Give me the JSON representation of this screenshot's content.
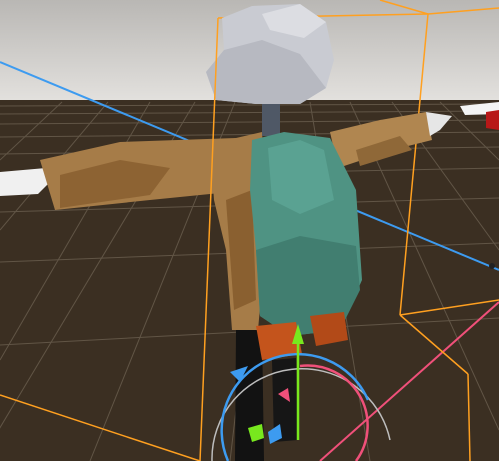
{
  "viewport": {
    "sky_top": "#b9b7b4",
    "sky_bottom": "#e3e1de",
    "ground": "#3b2f22",
    "grid_line": "#6e6252",
    "x_axis_color": "#3d9bf0",
    "z_axis_color": "#f0507a",
    "y_axis_color": "#78e81e",
    "bounds_color": "#ffa020"
  },
  "character": {
    "head_color": "#c9cbd2",
    "coat_color": "#a67c48",
    "backpack_color": "#4f9383",
    "boots_color": "#c4541c",
    "legs_color": "#121212",
    "hands_color": "#e6e6e6"
  },
  "gizmo": {
    "mode": "rotate",
    "axes": [
      "x",
      "y",
      "z"
    ]
  }
}
